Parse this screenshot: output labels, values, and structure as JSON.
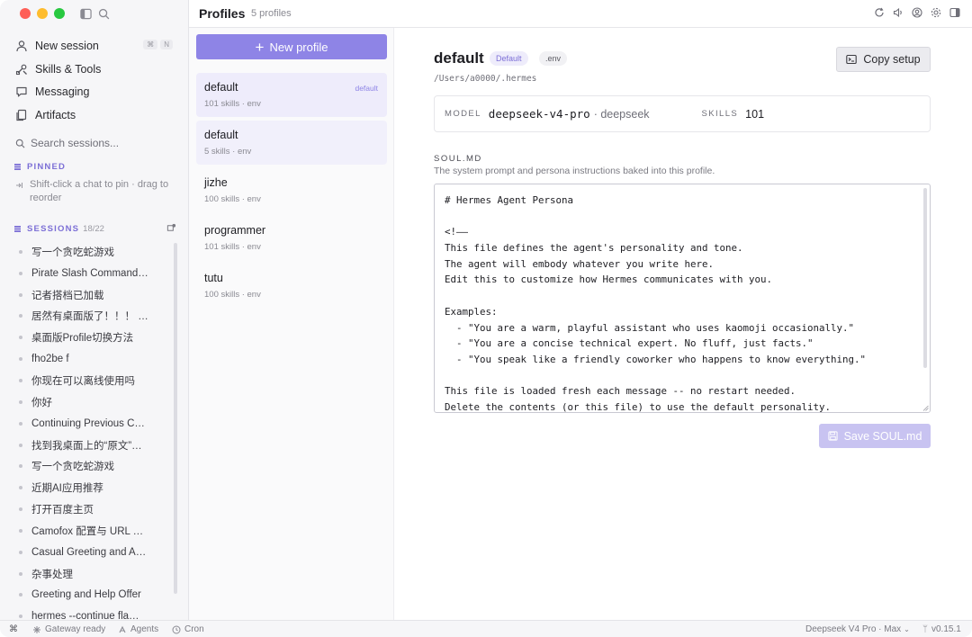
{
  "sidebar": {
    "nav": [
      {
        "label": "New session",
        "icon": "user-icon",
        "kbd": [
          "⌘",
          "N"
        ]
      },
      {
        "label": "Skills & Tools",
        "icon": "tools-icon"
      },
      {
        "label": "Messaging",
        "icon": "chat-icon"
      },
      {
        "label": "Artifacts",
        "icon": "document-icon"
      }
    ],
    "search_placeholder": "Search sessions...",
    "pinned_title": "PINNED",
    "pinned_hint": "Shift-click a chat to pin · drag to reorder",
    "sessions_title": "SESSIONS",
    "sessions_count": "18/22",
    "sessions": [
      "写一个贪吃蛇游戏",
      "Pirate Slash Command…",
      "记者搭档已加载",
      "居然有桌面版了！！！ …",
      "桌面版Profile切换方法",
      "fho2be f",
      "你现在可以离线使用吗",
      "你好",
      "Continuing Previous C…",
      "找到我桌面上的“原文”…",
      "写一个贪吃蛇游戏",
      "近期AI应用推荐",
      "打开百度主页",
      "Camofox 配置与 URL …",
      "Casual Greeting and A…",
      "杂事处理",
      "Greeting and Help Offer",
      "hermes --continue fla…"
    ]
  },
  "topbar": {
    "title": "Profiles",
    "subtitle": "5 profiles"
  },
  "profiles": {
    "new_button": "New profile",
    "items": [
      {
        "name": "default",
        "meta": "101 skills · env",
        "tag": "default"
      },
      {
        "name": "default",
        "meta": "5 skills · env",
        "tag": ""
      },
      {
        "name": "jizhe",
        "meta": "100 skills · env",
        "tag": ""
      },
      {
        "name": "programmer",
        "meta": "101 skills · env",
        "tag": ""
      },
      {
        "name": "tutu",
        "meta": "100 skills · env",
        "tag": ""
      }
    ]
  },
  "detail": {
    "name": "default",
    "badge_default": "Default",
    "badge_env": ".env",
    "path": "/Users/a0000/.hermes",
    "copy_button": "Copy setup",
    "model_key": "MODEL",
    "model_value": "deepseek-v4-pro",
    "model_provider": "· deepseek",
    "skills_key": "SKILLS",
    "skills_value": "101",
    "soul_title": "SOUL.MD",
    "soul_subtitle": "The system prompt and persona instructions baked into this profile.",
    "soul_lines": [
      "# Hermes Agent Persona",
      "",
      "<!——",
      "This file defines the agent's personality and tone.",
      "The agent will embody whatever you write here.",
      "Edit this to customize how Hermes communicates with you.",
      "",
      "Examples:",
      "  - \"You are a warm, playful assistant who uses kaomoji occasionally.\"",
      "  - \"You are a concise technical expert. No fluff, just facts.\"",
      "  - \"You speak like a friendly coworker who happens to know everything.\"",
      "",
      "This file is loaded fresh each message -- no restart needed.",
      "Delete the contents (or this file) to use the default personality."
    ],
    "save_button": "Save SOUL.md"
  },
  "status": {
    "gateway": "Gateway ready",
    "agents": "Agents",
    "cron": "Cron",
    "model": "Deepseek V4 Pro · Max",
    "version": "v0.15.1"
  },
  "colors": {
    "accent": "#8e84e6",
    "accent_light": "#eeecfb",
    "save_disabled": "#c8c3f1"
  }
}
